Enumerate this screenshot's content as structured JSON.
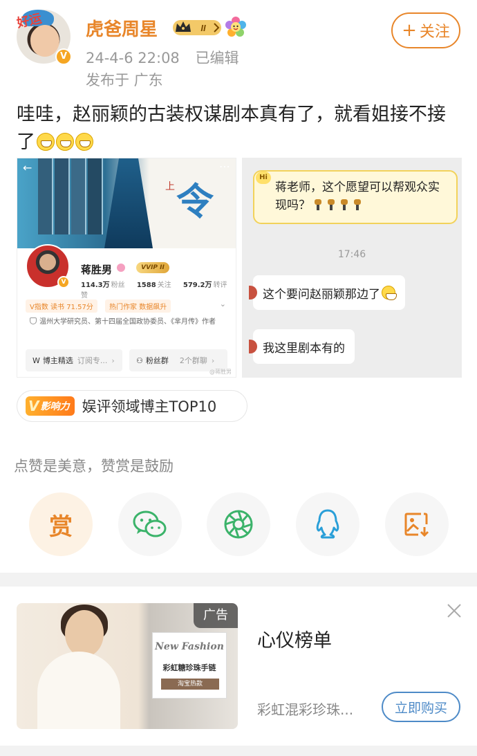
{
  "post": {
    "username": "虎爸周星",
    "level_badge": "II",
    "timestamp": "24-4-6 22:08",
    "edited": "已编辑",
    "location": "发布于 广东",
    "follow_label": "关注",
    "text": "哇哇，赵丽颖的古装权谋剧本真有了，就看姐接不接了",
    "emoji_count": 3,
    "avatar_tag": "好运"
  },
  "image_left": {
    "book_glyph": "令",
    "book_glyph_small": "上",
    "profile_name": "蒋胜男",
    "vip_badge": "VVIP II",
    "stats": [
      {
        "value": "114.3万",
        "label": "粉丝"
      },
      {
        "value": "1588",
        "label": "关注"
      },
      {
        "value": "579.2万",
        "label": "转评赞"
      }
    ],
    "tags": [
      "V指数 读书 71.57分",
      "热门作家 数据飙升"
    ],
    "bio": "温州大学研究员、第十四届全国政协委员、《芈月传》作者",
    "btn_left_label": "博主精选",
    "btn_left_sub": "订阅专...",
    "btn_right_label": "粉丝群",
    "btn_right_sub": "2个群聊",
    "watermark": "@蒋胜男"
  },
  "image_right": {
    "hi_tag": "Hi",
    "question": "蒋老师，这个愿望可以帮观众实现吗？",
    "time": "17:46",
    "reply1": "这个要问赵丽颖那边了",
    "reply2": "我这里剧本有的"
  },
  "influence": {
    "badge_v": "V",
    "badge_text": "影响力",
    "text": "娱评领域博主TOP10"
  },
  "reward": {
    "hint": "点赞是美意，赞赏是鼓励",
    "reward_glyph": "赏"
  },
  "ad": {
    "label": "广告",
    "card_title": "New Fashion",
    "card_subtitle": "彩虹糖珍珠手链",
    "card_button": "淘宝热款",
    "title": "心仪榜单",
    "description": "彩虹混彩珍珠...",
    "buy_label": "立即购买"
  },
  "colors": {
    "accent": "#e8862a",
    "link_blue": "#4d8ac7",
    "wechat_green": "#3bb36a",
    "qq_blue": "#2a9fd8"
  },
  "icons": [
    "wechat-icon",
    "moments-icon",
    "qq-icon",
    "save-image-icon",
    "close-icon"
  ]
}
